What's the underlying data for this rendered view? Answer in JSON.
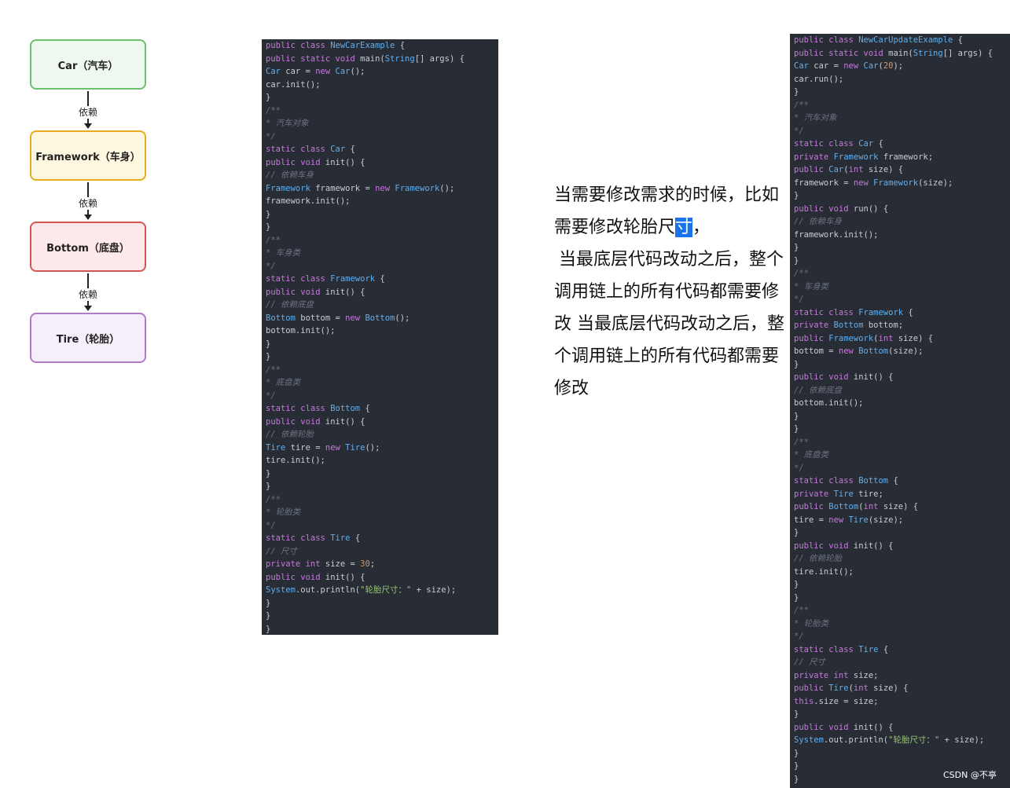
{
  "diagram": {
    "nodes": [
      {
        "label": "Car（汽车）",
        "border": "#6cc06c",
        "fill": "#eef8ee"
      },
      {
        "label": "Framework（车身）",
        "border": "#e6ac1c",
        "fill": "#fff8e0"
      },
      {
        "label": "Bottom（底盘）",
        "border": "#d05656",
        "fill": "#fde9e9"
      },
      {
        "label": "Tire（轮胎）",
        "border": "#b07cc8",
        "fill": "#f6eefa"
      }
    ],
    "edge_labels": [
      "依赖",
      "依赖",
      "依赖"
    ]
  },
  "code_left": [
    "public class NewCarExample {",
    "public static void main(String[] args) {",
    "Car car = new Car();",
    "car.init();",
    "}",
    "/**",
    "* 汽车对象",
    "*/",
    "static class Car {",
    "public void init() {",
    "// 依赖车身",
    "Framework framework = new Framework();",
    "framework.init();",
    "}",
    "}",
    "/**",
    "* 车身类",
    "*/",
    "static class Framework {",
    "public void init() {",
    "// 依赖底盘",
    "Bottom bottom = new Bottom();",
    "bottom.init();",
    "}",
    "}",
    "/**",
    "* 底盘类",
    "*/",
    "static class Bottom {",
    "public void init() {",
    "// 依赖轮胎",
    "Tire tire = new Tire();",
    "tire.init();",
    "}",
    "}",
    "/**",
    "* 轮胎类",
    "*/",
    "static class Tire {",
    "// 尺寸",
    "private int size = 30;",
    "public void init() {",
    "System.out.println(\"轮胎尺寸：\" + size);",
    "}",
    "}",
    "}"
  ],
  "code_right": [
    "public class NewCarUpdateExample {",
    "public static void main(String[] args) {",
    "Car car = new Car(20);",
    "car.run();",
    "}",
    "/**",
    "* 汽车对象",
    "*/",
    "static class Car {",
    "private Framework framework;",
    "public Car(int size) {",
    "framework = new Framework(size);",
    "}",
    "public void run() {",
    "// 依赖车身",
    "framework.init();",
    "}",
    "}",
    "/**",
    "* 车身类",
    "*/",
    "static class Framework {",
    "private Bottom bottom;",
    "public Framework(int size) {",
    "bottom = new Bottom(size);",
    "}",
    "public void init() {",
    "// 依赖底盘",
    "bottom.init();",
    "}",
    "}",
    "/**",
    "* 底盘类",
    "*/",
    "static class Bottom {",
    "private Tire tire;",
    "public Bottom(int size) {",
    "tire = new Tire(size);",
    "}",
    "public void init() {",
    "// 依赖轮胎",
    "tire.init();",
    "}",
    "}",
    "/**",
    "* 轮胎类",
    "*/",
    "static class Tire {",
    "// 尺寸",
    "private int size;",
    "public Tire(int size) {",
    "this.size = size;",
    "}",
    "public void init() {",
    "System.out.println(\"轮胎尺寸：\" + size);",
    "}",
    "}",
    "}"
  ],
  "note": {
    "before_highlight": "当需要修改需求的时候，比如需要修改轮胎尺",
    "highlight": "寸",
    "after_highlight": "，",
    "rest": "当最底层代码改动之后，整个调用链上的所有代码都需要修改 当最底层代码改动之后，整个调用链上的所有代码都需要修改"
  },
  "watermark": "CSDN @不亭"
}
